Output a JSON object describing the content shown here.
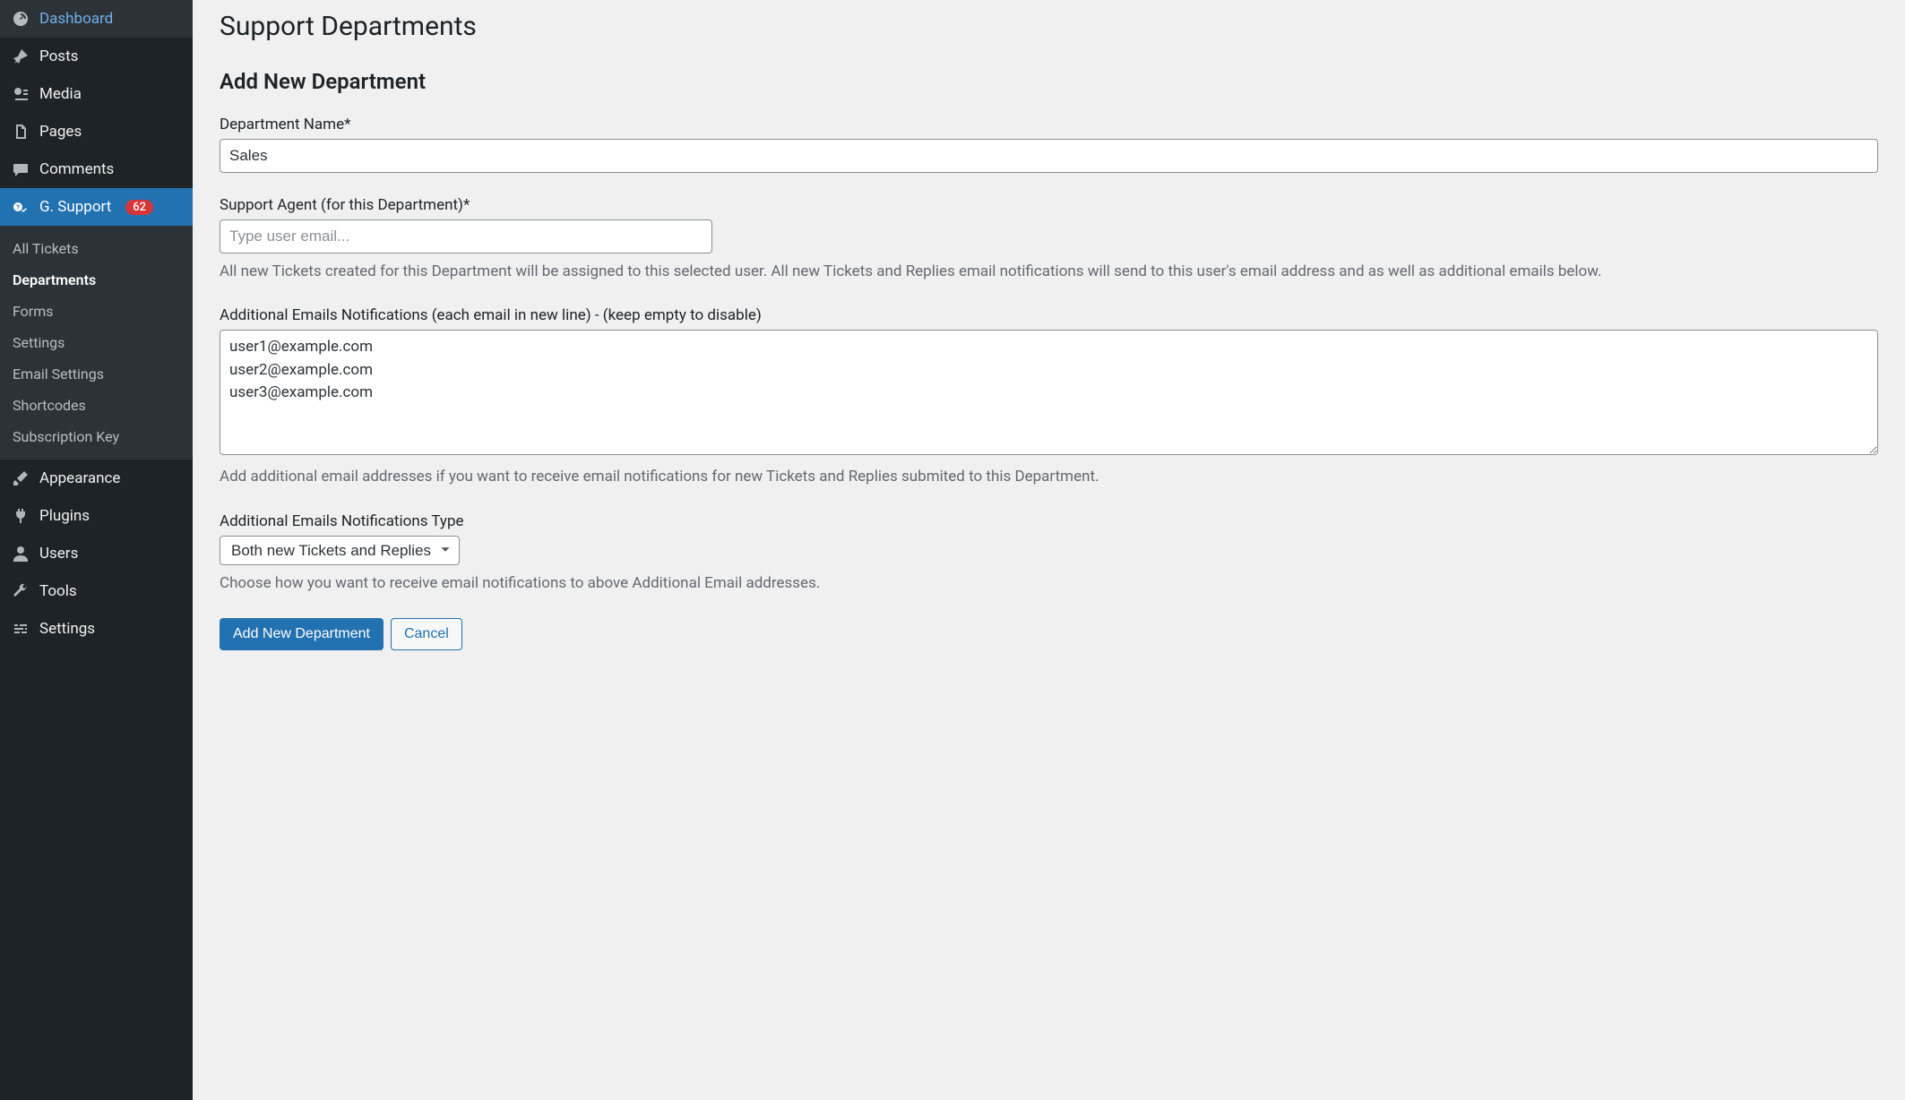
{
  "sidebar": {
    "main_menu": [
      {
        "label": "Dashboard",
        "icon": "dashboard"
      },
      {
        "label": "Posts",
        "icon": "pin"
      },
      {
        "label": "Media",
        "icon": "media"
      },
      {
        "label": "Pages",
        "icon": "page"
      },
      {
        "label": "Comments",
        "icon": "comment"
      },
      {
        "label": "G. Support",
        "icon": "support",
        "active": true,
        "badge": "62"
      }
    ],
    "submenu": [
      {
        "label": "All Tickets"
      },
      {
        "label": "Departments",
        "current": true
      },
      {
        "label": "Forms"
      },
      {
        "label": "Settings"
      },
      {
        "label": "Email Settings"
      },
      {
        "label": "Shortcodes"
      },
      {
        "label": "Subscription Key"
      }
    ],
    "bottom_menu": [
      {
        "label": "Appearance",
        "icon": "brush"
      },
      {
        "label": "Plugins",
        "icon": "plug"
      },
      {
        "label": "Users",
        "icon": "user"
      },
      {
        "label": "Tools",
        "icon": "wrench"
      },
      {
        "label": "Settings",
        "icon": "sliders"
      }
    ]
  },
  "page": {
    "title": "Support Departments",
    "subtitle": "Add New Department",
    "fields": {
      "dept_name": {
        "label": "Department Name*",
        "value": "Sales"
      },
      "support_agent": {
        "label": "Support Agent (for this Department)*",
        "placeholder": "Type user email...",
        "description": "All new Tickets created for this Department will be assigned to this selected user. All new Tickets and Replies email notifications will send to this user's email address and as well as additional emails below."
      },
      "additional_emails": {
        "label": "Additional Emails Notifications (each email in new line) - (keep empty to disable)",
        "value": "user1@example.com\nuser2@example.com\nuser3@example.com",
        "description": "Add additional email addresses if you want to receive email notifications for new Tickets and Replies submited to this Department."
      },
      "notification_type": {
        "label": "Additional Emails Notifications Type",
        "selected": "Both new Tickets and Replies",
        "description": "Choose how you want to receive email notifications to above Additional Email addresses."
      }
    },
    "buttons": {
      "submit": "Add New Department",
      "cancel": "Cancel"
    }
  }
}
